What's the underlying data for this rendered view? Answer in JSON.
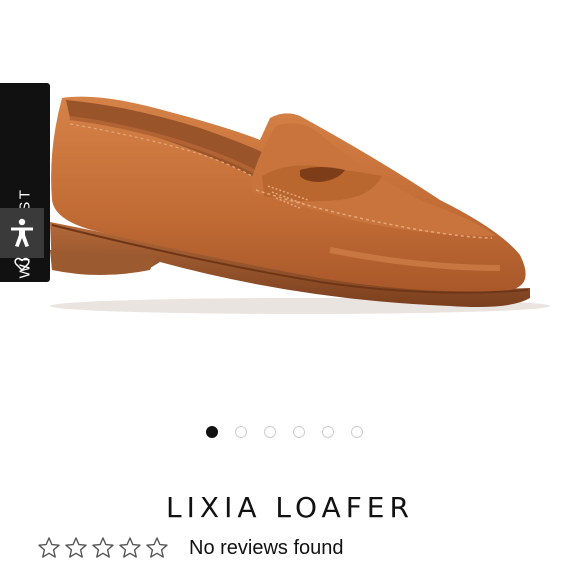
{
  "wishlist": {
    "label": "WISHLIST"
  },
  "product": {
    "title": "LIXIA LOAFER"
  },
  "carousel": {
    "dot_count": 6,
    "active_index": 0
  },
  "rating": {
    "stars_total": 5,
    "stars_filled": 0,
    "review_text": "No reviews found"
  },
  "colors": {
    "leather": "#c5723c",
    "sole": "#8a4a24",
    "tab_bg": "#111111",
    "dot_active": "#111111",
    "dot_inactive": "#cfcfcf"
  },
  "icons": [
    "accessibility-icon",
    "heart-icon",
    "star-icon"
  ]
}
